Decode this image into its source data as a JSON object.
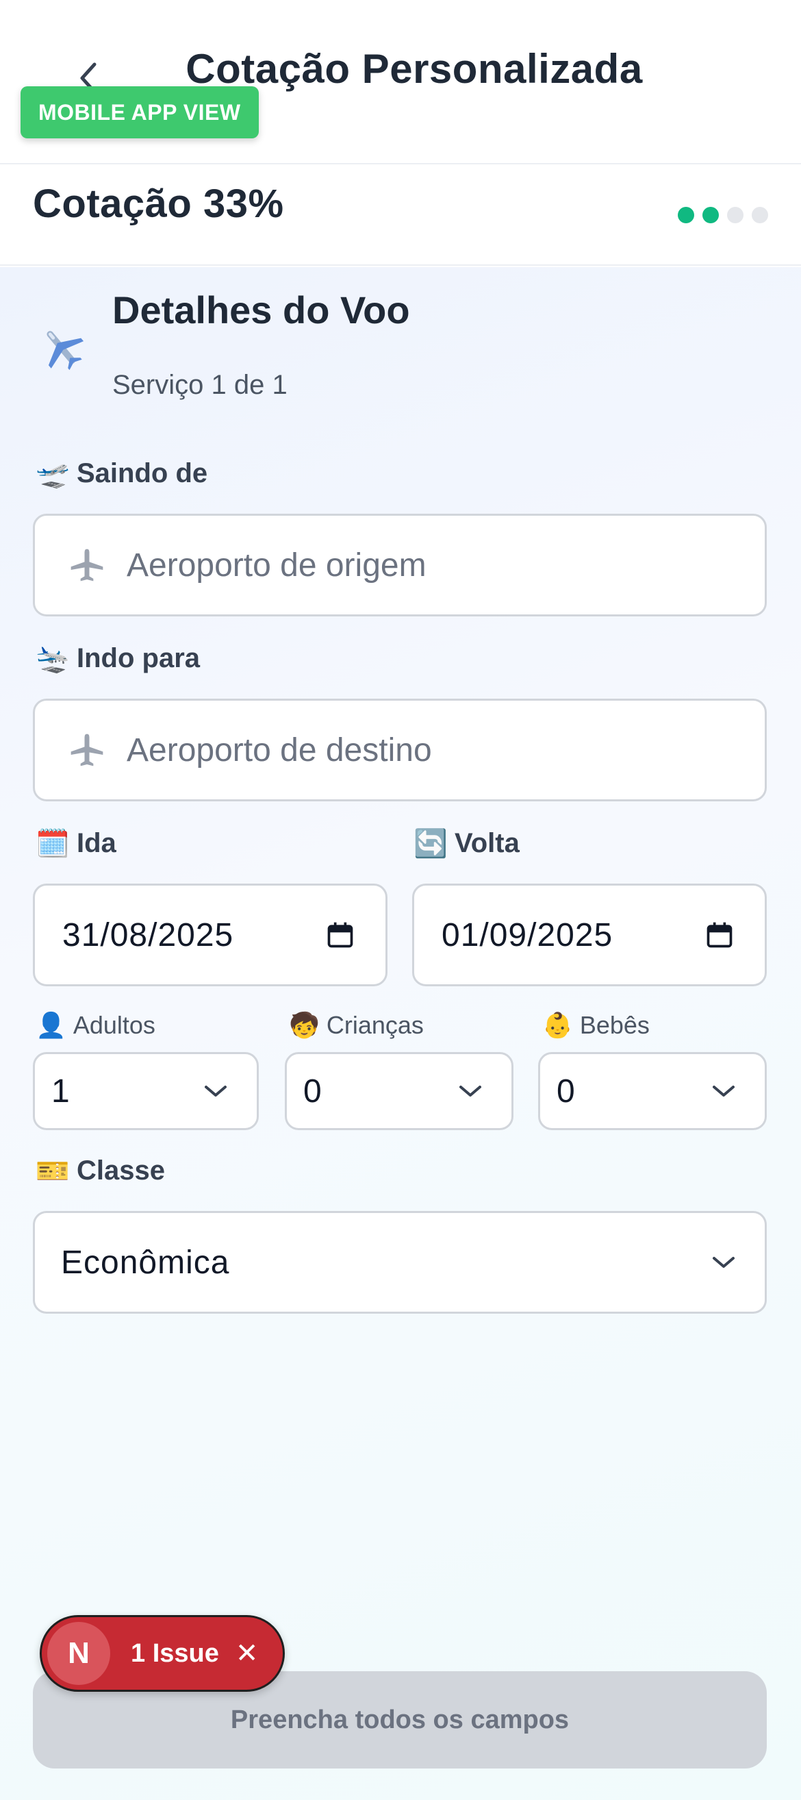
{
  "header": {
    "title": "Cotação Personalizada",
    "badge": "MOBILE APP VIEW"
  },
  "progress": {
    "label": "Cotação 33%",
    "steps_total": 4,
    "steps_done": 2
  },
  "section": {
    "icon": "airplane-icon",
    "title": "Detalhes do Voo",
    "subtitle": "Serviço 1 de 1"
  },
  "form": {
    "origin": {
      "label": "Saindo de",
      "emoji": "🛫",
      "placeholder": "Aeroporto de origem"
    },
    "destination": {
      "label": "Indo para",
      "emoji": "🛬",
      "placeholder": "Aeroporto de destino"
    },
    "departure": {
      "label": "Ida",
      "emoji": "🗓️",
      "value": "31/08/2025"
    },
    "return": {
      "label": "Volta",
      "emoji": "🔄",
      "value": "01/09/2025"
    },
    "adults": {
      "label": "Adultos",
      "emoji": "👤",
      "value": "1"
    },
    "children": {
      "label": "Crianças",
      "emoji": "🧒",
      "value": "0"
    },
    "infants": {
      "label": "Bebês",
      "emoji": "👶",
      "value": "0"
    },
    "class": {
      "label": "Classe",
      "emoji": "🎫",
      "value": "Econômica"
    }
  },
  "submit_label": "Preencha todos os campos",
  "issue_badge": {
    "letter": "N",
    "label": "1 Issue",
    "close": "✕"
  },
  "colors": {
    "accent": "#10b981",
    "badge": "#3ec96e",
    "issue": "#c62a33"
  }
}
